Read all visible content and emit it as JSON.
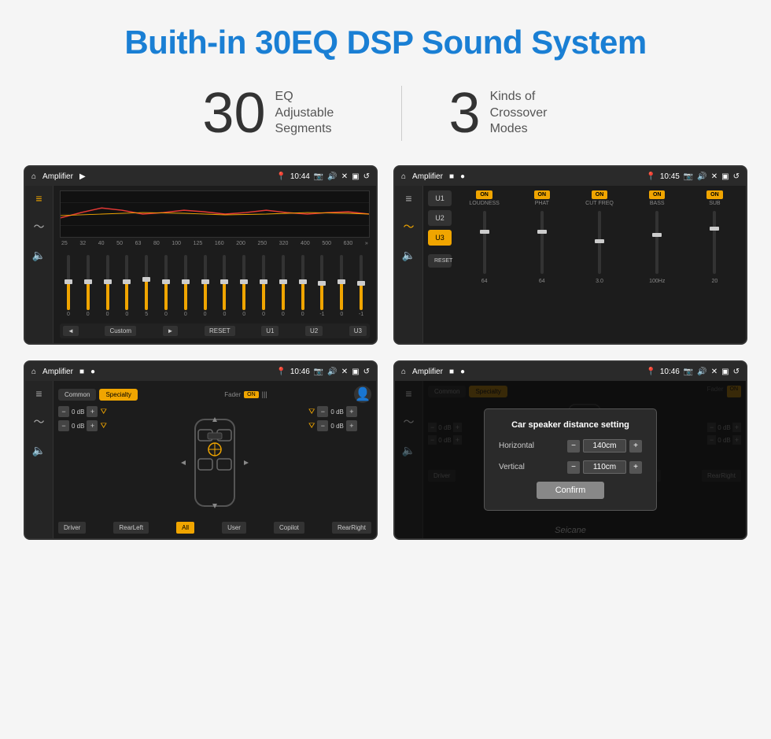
{
  "page": {
    "title": "Buith-in 30EQ DSP Sound System",
    "stat1_number": "30",
    "stat1_label_line1": "EQ Adjustable",
    "stat1_label_line2": "Segments",
    "stat2_number": "3",
    "stat2_label_line1": "Kinds of",
    "stat2_label_line2": "Crossover Modes"
  },
  "screen1": {
    "title": "Amplifier",
    "time": "10:44",
    "eq_frequencies": [
      "25",
      "32",
      "40",
      "50",
      "63",
      "80",
      "100",
      "125",
      "160",
      "200",
      "250",
      "320",
      "400",
      "500",
      "630"
    ],
    "eq_values": [
      "0",
      "0",
      "0",
      "0",
      "5",
      "0",
      "0",
      "0",
      "0",
      "0",
      "0",
      "0",
      "0",
      "-1",
      "0",
      "-1"
    ],
    "bottom_buttons": [
      "◄",
      "Custom",
      "►",
      "RESET",
      "U1",
      "U2",
      "U3"
    ]
  },
  "screen2": {
    "title": "Amplifier",
    "time": "10:45",
    "presets": [
      "U1",
      "U2",
      "U3"
    ],
    "active_preset": "U3",
    "channels": [
      "LOUDNESS",
      "PHAT",
      "CUT FREQ",
      "BASS",
      "SUB"
    ],
    "channel_on": [
      true,
      true,
      true,
      true,
      true
    ],
    "reset_label": "RESET"
  },
  "screen3": {
    "title": "Amplifier",
    "time": "10:46",
    "tabs": [
      "Common",
      "Specialty"
    ],
    "active_tab": "Specialty",
    "fader_label": "Fader",
    "fader_on": "ON",
    "db_labels": [
      "0 dB",
      "0 dB",
      "0 dB",
      "0 dB"
    ],
    "position_buttons": [
      "Driver",
      "RearLeft",
      "All",
      "User",
      "Copilot",
      "RearRight"
    ]
  },
  "screen4": {
    "title": "Amplifier",
    "time": "10:46",
    "tabs": [
      "Common",
      "Specialty"
    ],
    "active_tab": "Specialty",
    "dialog": {
      "title": "Car speaker distance setting",
      "horizontal_label": "Horizontal",
      "horizontal_value": "140cm",
      "vertical_label": "Vertical",
      "vertical_value": "110cm",
      "confirm_label": "Confirm"
    }
  },
  "watermark": "Seicane"
}
